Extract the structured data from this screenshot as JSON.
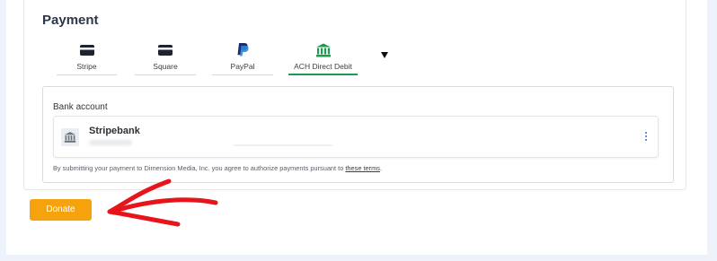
{
  "section": {
    "title": "Payment"
  },
  "tabs": [
    {
      "label": "Stripe",
      "icon": "card-icon",
      "active": false
    },
    {
      "label": "Square",
      "icon": "card-icon",
      "active": false
    },
    {
      "label": "PayPal",
      "icon": "paypal-icon",
      "active": false
    },
    {
      "label": "ACH Direct Debit",
      "icon": "bank-icon",
      "active": true
    }
  ],
  "more_icon": "caret-down-icon",
  "bank": {
    "label": "Bank account",
    "name": "Stripebank",
    "icon": "bank-icon"
  },
  "notice": {
    "text": "By submitting your payment to Dimension Media, Inc. you agree to authorize payments pursuant to ",
    "link": "these terms",
    "end": "."
  },
  "donate_label": "Donate",
  "colors": {
    "accent_green": "#1a9c4f",
    "donate_orange": "#f5a20c",
    "annotation_red": "#e8141a"
  }
}
